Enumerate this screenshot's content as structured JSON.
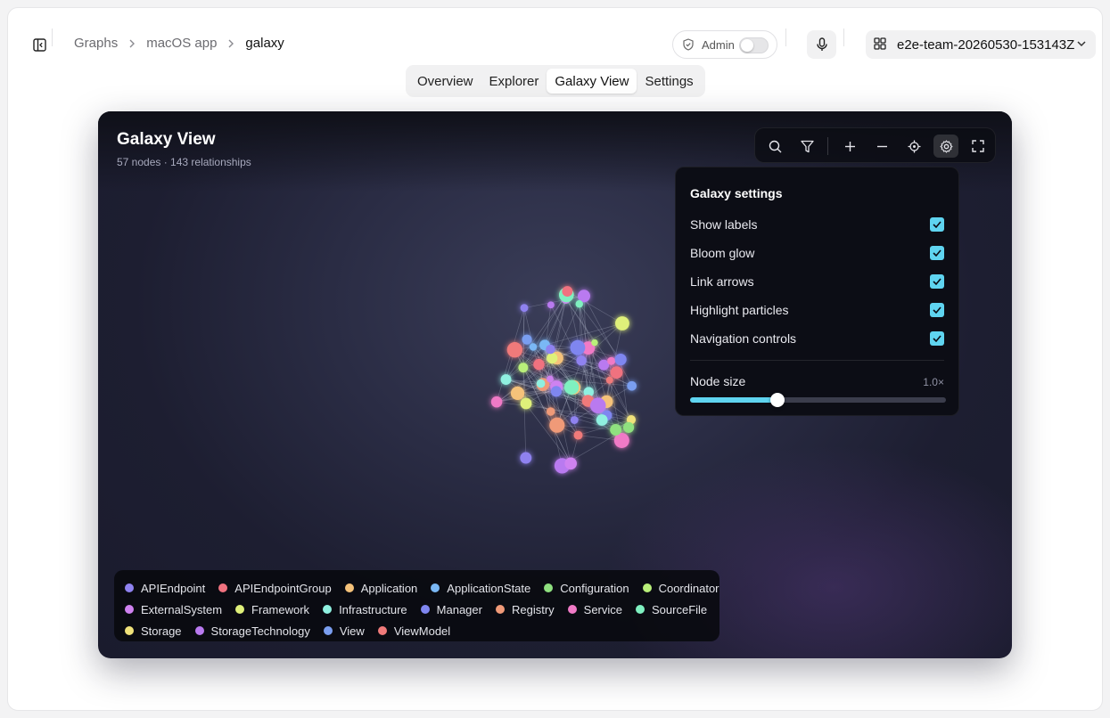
{
  "breadcrumb": [
    "Graphs",
    "macOS app",
    "galaxy"
  ],
  "admin_label": "Admin",
  "team_selector": "e2e-team-20260530-153143Z",
  "tabs": [
    {
      "label": "Overview",
      "active": false
    },
    {
      "label": "Explorer",
      "active": false
    },
    {
      "label": "Galaxy View",
      "active": true
    },
    {
      "label": "Settings",
      "active": false
    }
  ],
  "galaxy": {
    "title": "Galaxy View",
    "subtitle": "57 nodes · 143 relationships",
    "toolbar": [
      "search-icon",
      "filter-icon",
      "zoom-in-icon",
      "zoom-out-icon",
      "locate-icon",
      "settings-icon",
      "fullscreen-icon"
    ],
    "settings": {
      "title": "Galaxy settings",
      "options": [
        {
          "label": "Show labels",
          "checked": true
        },
        {
          "label": "Bloom glow",
          "checked": true
        },
        {
          "label": "Link arrows",
          "checked": true
        },
        {
          "label": "Highlight particles",
          "checked": true
        },
        {
          "label": "Navigation controls",
          "checked": true
        }
      ],
      "node_size_label": "Node size",
      "node_size_value": "1.0×",
      "node_size_fraction": 0.34
    },
    "legend": [
      [
        {
          "label": "APIEndpoint",
          "color": "#8f82f0"
        },
        {
          "label": "APIEndpointGroup",
          "color": "#f0727f"
        },
        {
          "label": "Application",
          "color": "#f5c27a"
        },
        {
          "label": "ApplicationState",
          "color": "#7ab8f5"
        },
        {
          "label": "Configuration",
          "color": "#8fe07f"
        },
        {
          "label": "Coordinator",
          "color": "#b9ef7a"
        }
      ],
      [
        {
          "label": "ExternalSystem",
          "color": "#cf82f0"
        },
        {
          "label": "Framework",
          "color": "#dff07a"
        },
        {
          "label": "Infrastructure",
          "color": "#8ff0e0"
        },
        {
          "label": "Manager",
          "color": "#7f86f0"
        },
        {
          "label": "Registry",
          "color": "#f09a78"
        },
        {
          "label": "Service",
          "color": "#f07ac6"
        },
        {
          "label": "SourceFile",
          "color": "#7ff0c0"
        }
      ],
      [
        {
          "label": "Storage",
          "color": "#f0e27a"
        },
        {
          "label": "StorageTechnology",
          "color": "#b97af0"
        },
        {
          "label": "View",
          "color": "#7a9ef0"
        },
        {
          "label": "ViewModel",
          "color": "#f07a7a"
        }
      ]
    ]
  }
}
